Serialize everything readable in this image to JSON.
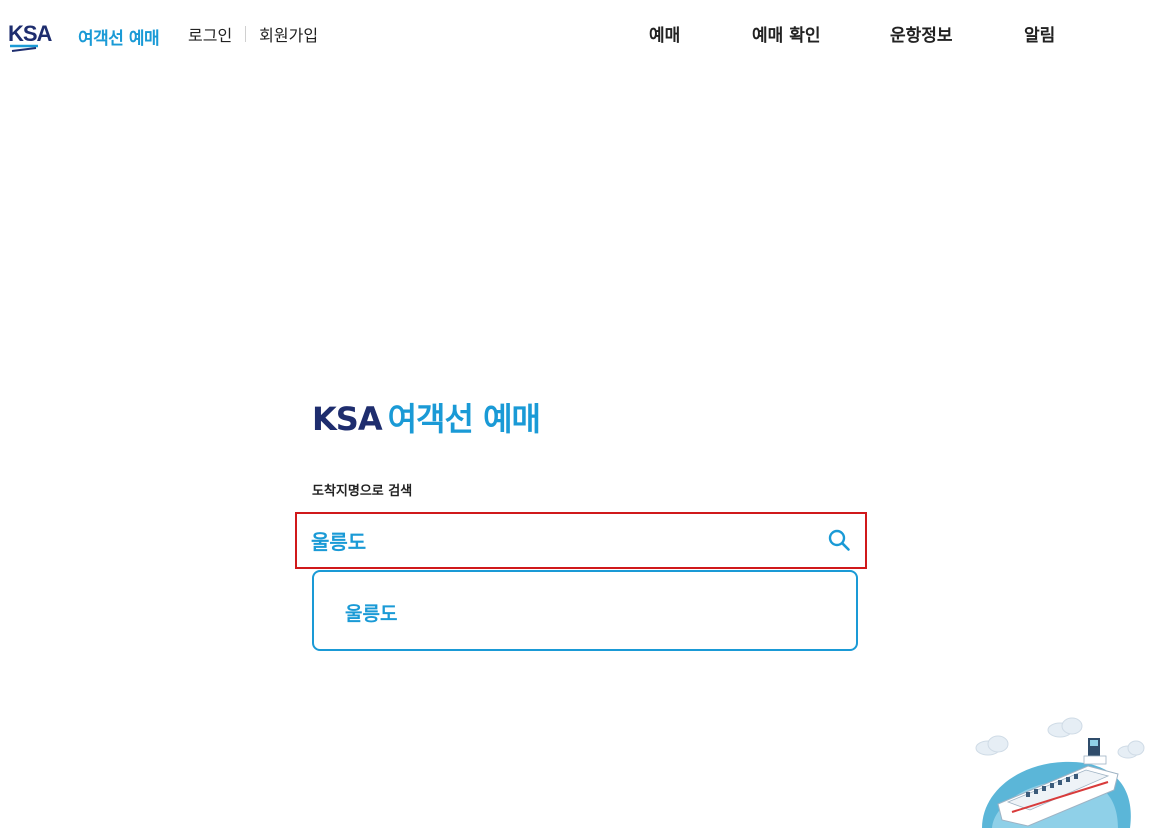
{
  "header": {
    "logo_brand": "KSA",
    "logo_service": "여객선 예매",
    "login_label": "로그인",
    "signup_label": "회원가입",
    "nav": [
      {
        "label": "예매"
      },
      {
        "label": "예매 확인"
      },
      {
        "label": "운항정보"
      },
      {
        "label": "알림"
      }
    ]
  },
  "main": {
    "title_brand": "KSA",
    "title_service": "여객선 예매",
    "search_label": "도착지명으로 검색",
    "search_value": "울릉도",
    "suggestions": [
      {
        "label": "울릉도"
      }
    ]
  },
  "colors": {
    "brand_navy": "#1e2d6e",
    "accent_blue": "#1a9ad6",
    "highlight_red": "#d0191b"
  },
  "icons": {
    "search": "search-icon",
    "ship": "ship-illustration"
  }
}
